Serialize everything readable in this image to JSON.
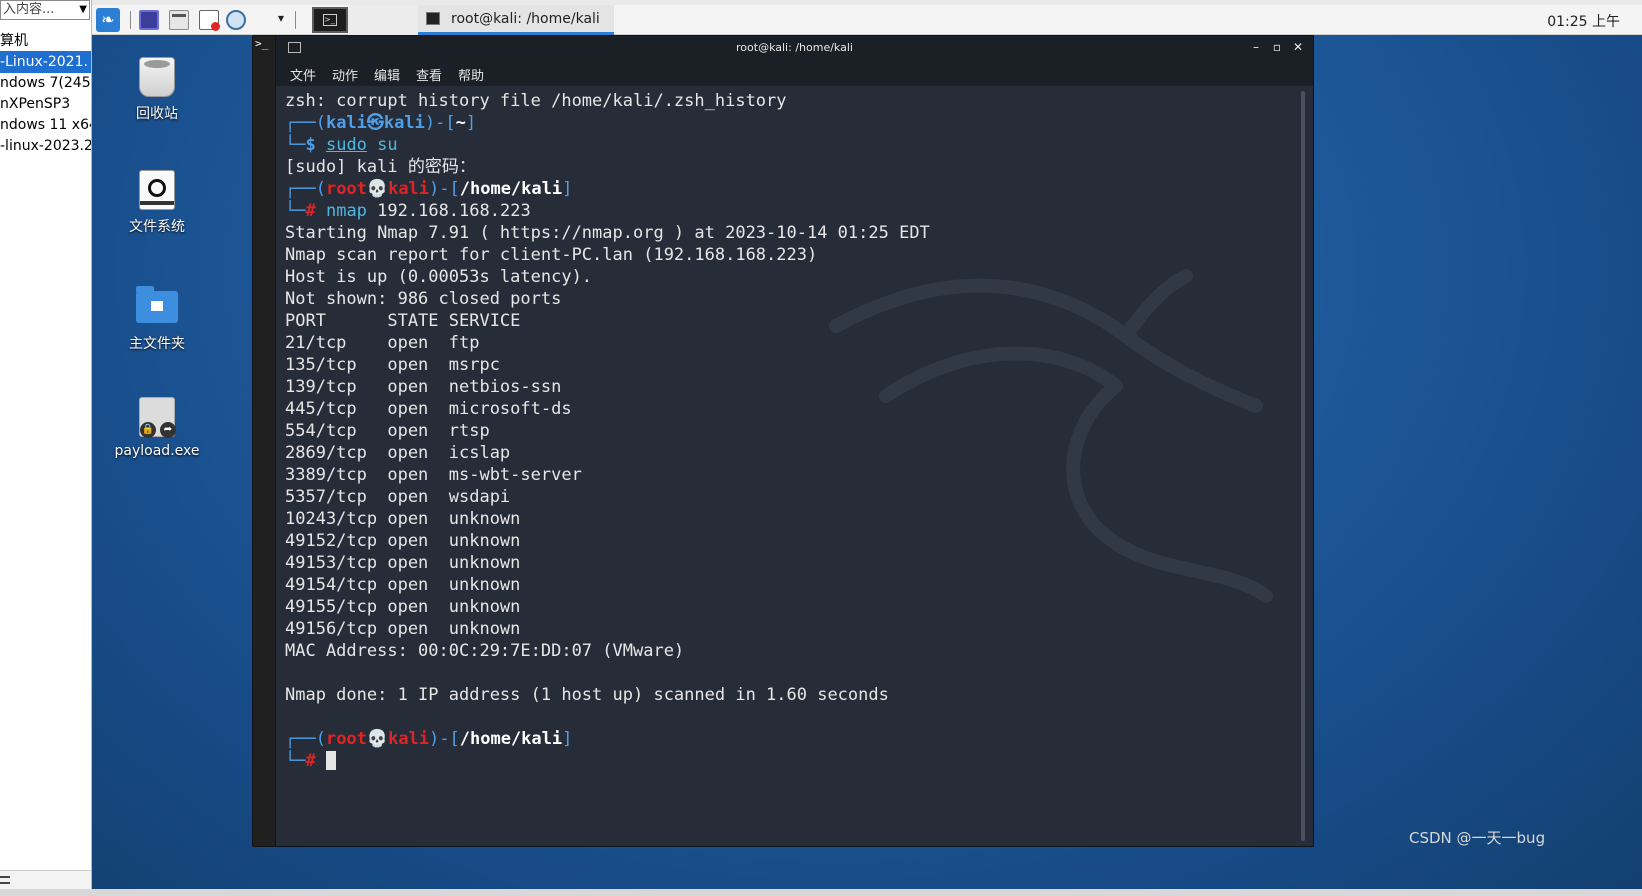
{
  "library": {
    "search_text": "入内容...",
    "items": [
      {
        "label": "算机",
        "selected": false
      },
      {
        "label": "-Linux-2021.",
        "selected": true
      },
      {
        "label": "ndows 7(245.",
        "selected": false
      },
      {
        "label": "nXPenSP3",
        "selected": false
      },
      {
        "label": "ndows 11 x64",
        "selected": false
      },
      {
        "label": "-linux-2023.2",
        "selected": false
      }
    ]
  },
  "panel": {
    "task_label": "root@kali: /home/kali",
    "clock": "01:25 上午"
  },
  "desktop_icons": [
    {
      "name": "trash",
      "label": "回收站"
    },
    {
      "name": "filesystem",
      "label": "文件系统"
    },
    {
      "name": "home",
      "label": "主文件夹"
    },
    {
      "name": "payload",
      "label": "payload.exe"
    }
  ],
  "terminal": {
    "title": "root@kali: /home/kali",
    "menu": [
      "文件",
      "动作",
      "编辑",
      "查看",
      "帮助"
    ],
    "history_warning": "zsh: corrupt history file /home/kali/.zsh_history",
    "prompt1": {
      "open": "┌──(",
      "user": "kali",
      "at": "㉿",
      "host": "kali",
      "mid": ")-[",
      "dir": "~",
      "close": "]",
      "arrow": "└─",
      "sym": "$ ",
      "cmd_a": "sudo",
      "cmd_b": " su"
    },
    "sudo_prompt": "[sudo] kali 的密码：",
    "prompt2": {
      "open": "┌──(",
      "user": "root",
      "at": "💀",
      "host": "kali",
      "mid": ")-[",
      "dir": "/home/kali",
      "close": "]",
      "arrow": "└─",
      "sym": "# ",
      "cmd_a": "nmap",
      "cmd_b": " 192.168.168.223"
    },
    "output": [
      "Starting Nmap 7.91 ( https://nmap.org ) at 2023-10-14 01:25 EDT",
      "Nmap scan report for client-PC.lan (192.168.168.223)",
      "Host is up (0.00053s latency).",
      "Not shown: 986 closed ports",
      "PORT      STATE SERVICE",
      "21/tcp    open  ftp",
      "135/tcp   open  msrpc",
      "139/tcp   open  netbios-ssn",
      "445/tcp   open  microsoft-ds",
      "554/tcp   open  rtsp",
      "2869/tcp  open  icslap",
      "3389/tcp  open  ms-wbt-server",
      "5357/tcp  open  wsdapi",
      "10243/tcp open  unknown",
      "49152/tcp open  unknown",
      "49153/tcp open  unknown",
      "49154/tcp open  unknown",
      "49155/tcp open  unknown",
      "49156/tcp open  unknown",
      "MAC Address: 00:0C:29:7E:DD:07 (VMware)",
      "",
      "Nmap done: 1 IP address (1 host up) scanned in 1.60 seconds",
      ""
    ],
    "prompt3": {
      "open": "┌──(",
      "user": "root",
      "at": "💀",
      "host": "kali",
      "mid": ")-[",
      "dir": "/home/kali",
      "close": "]",
      "arrow": "└─",
      "sym": "# "
    }
  },
  "watermark": "CSDN @一天一bug",
  "colors": {
    "prompt_blue": "#4f9fe8",
    "root_red": "#e02424",
    "terminal_bg": "#262c38",
    "desktop_blue": "#1f5a9c"
  }
}
